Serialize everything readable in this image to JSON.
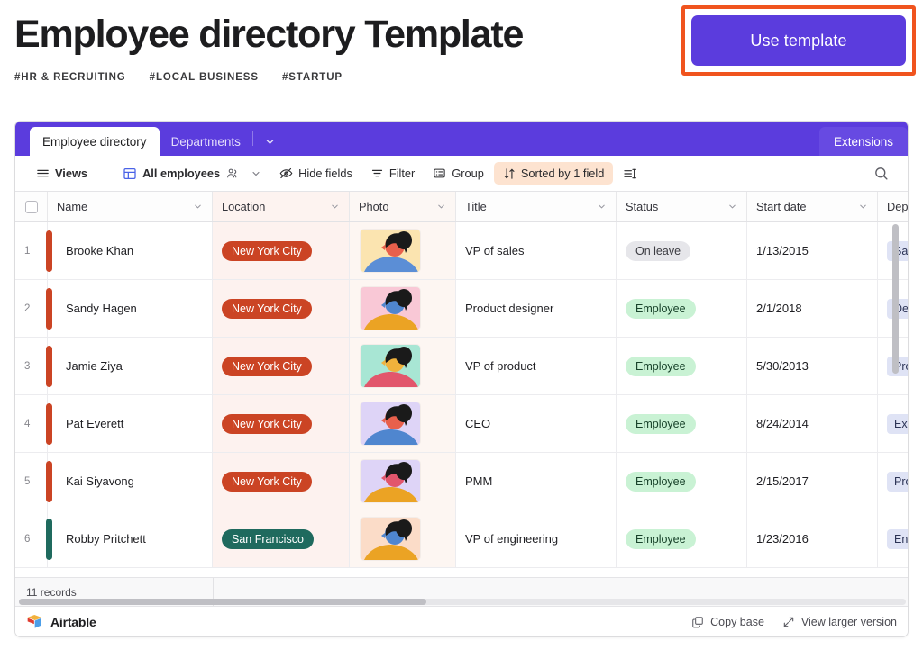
{
  "header": {
    "title": "Employee directory Template",
    "tags": [
      "#HR & RECRUITING",
      "#LOCAL BUSINESS",
      "#STARTUP"
    ],
    "cta_label": "Use template",
    "cta_color": "#5b3cdd",
    "highlight_color": "#f0541e"
  },
  "tabs": {
    "active": "Employee directory",
    "inactive": "Departments",
    "extensions": "Extensions"
  },
  "toolbar": {
    "views": "Views",
    "view_name": "All employees",
    "hide_fields": "Hide fields",
    "filter": "Filter",
    "group": "Group",
    "sort": "Sorted by 1 field",
    "sort_bg": "#fde3d0"
  },
  "grid": {
    "columns": [
      {
        "label": "Name"
      },
      {
        "label": "Location"
      },
      {
        "label": "Photo"
      },
      {
        "label": "Title"
      },
      {
        "label": "Status"
      },
      {
        "label": "Start date"
      },
      {
        "label": "Depa"
      }
    ],
    "rows": [
      {
        "num": "1",
        "name": "Brooke Khan",
        "location": "New York City",
        "title": "VP of sales",
        "status": "On leave",
        "status_kind": "leave",
        "start_date": "1/13/2015",
        "department": "Sale",
        "bar_color": "#cb4424",
        "loc_kind": "nyc",
        "photo": {
          "bg": "#fbe4b0",
          "hair": "#1a1a1a",
          "skin": "#e8604c",
          "shirt": "#5b8ed6"
        }
      },
      {
        "num": "2",
        "name": "Sandy Hagen",
        "location": "New York City",
        "title": "Product designer",
        "status": "Employee",
        "status_kind": "emp",
        "start_date": "2/1/2018",
        "department": "Desi",
        "bar_color": "#cb4424",
        "loc_kind": "nyc",
        "photo": {
          "bg": "#f9c8d6",
          "hair": "#1a1a1a",
          "skin": "#4f86cf",
          "shirt": "#eba324"
        }
      },
      {
        "num": "3",
        "name": "Jamie Ziya",
        "location": "New York City",
        "title": "VP of product",
        "status": "Employee",
        "status_kind": "emp",
        "start_date": "5/30/2013",
        "department": "Prod",
        "bar_color": "#cb4424",
        "loc_kind": "nyc",
        "photo": {
          "bg": "#a8e6d4",
          "hair": "#1a1a1a",
          "skin": "#f0b23c",
          "shirt": "#e2566c"
        }
      },
      {
        "num": "4",
        "name": "Pat Everett",
        "location": "New York City",
        "title": "CEO",
        "status": "Employee",
        "status_kind": "emp",
        "start_date": "8/24/2014",
        "department": "Exec",
        "bar_color": "#cb4424",
        "loc_kind": "nyc",
        "photo": {
          "bg": "#ded4f7",
          "hair": "#1a1a1a",
          "skin": "#e8604c",
          "shirt": "#4f86cf"
        }
      },
      {
        "num": "5",
        "name": "Kai Siyavong",
        "location": "New York City",
        "title": "PMM",
        "status": "Employee",
        "status_kind": "emp",
        "start_date": "2/15/2017",
        "department": "Prod",
        "bar_color": "#cb4424",
        "loc_kind": "nyc",
        "photo": {
          "bg": "#ded4f7",
          "hair": "#1a1a1a",
          "skin": "#e2566c",
          "shirt": "#eba324"
        }
      },
      {
        "num": "6",
        "name": "Robby Pritchett",
        "location": "San Francisco",
        "title": "VP of engineering",
        "status": "Employee",
        "status_kind": "emp",
        "start_date": "1/23/2016",
        "department": "Engi",
        "bar_color": "#1f6a5e",
        "loc_kind": "sf",
        "photo": {
          "bg": "#fbdcc8",
          "hair": "#1a1a1a",
          "skin": "#4f86cf",
          "shirt": "#eba324"
        }
      }
    ],
    "record_count": "11 records"
  },
  "footer": {
    "brand": "Airtable",
    "copy_base": "Copy base",
    "view_larger": "View larger version"
  }
}
